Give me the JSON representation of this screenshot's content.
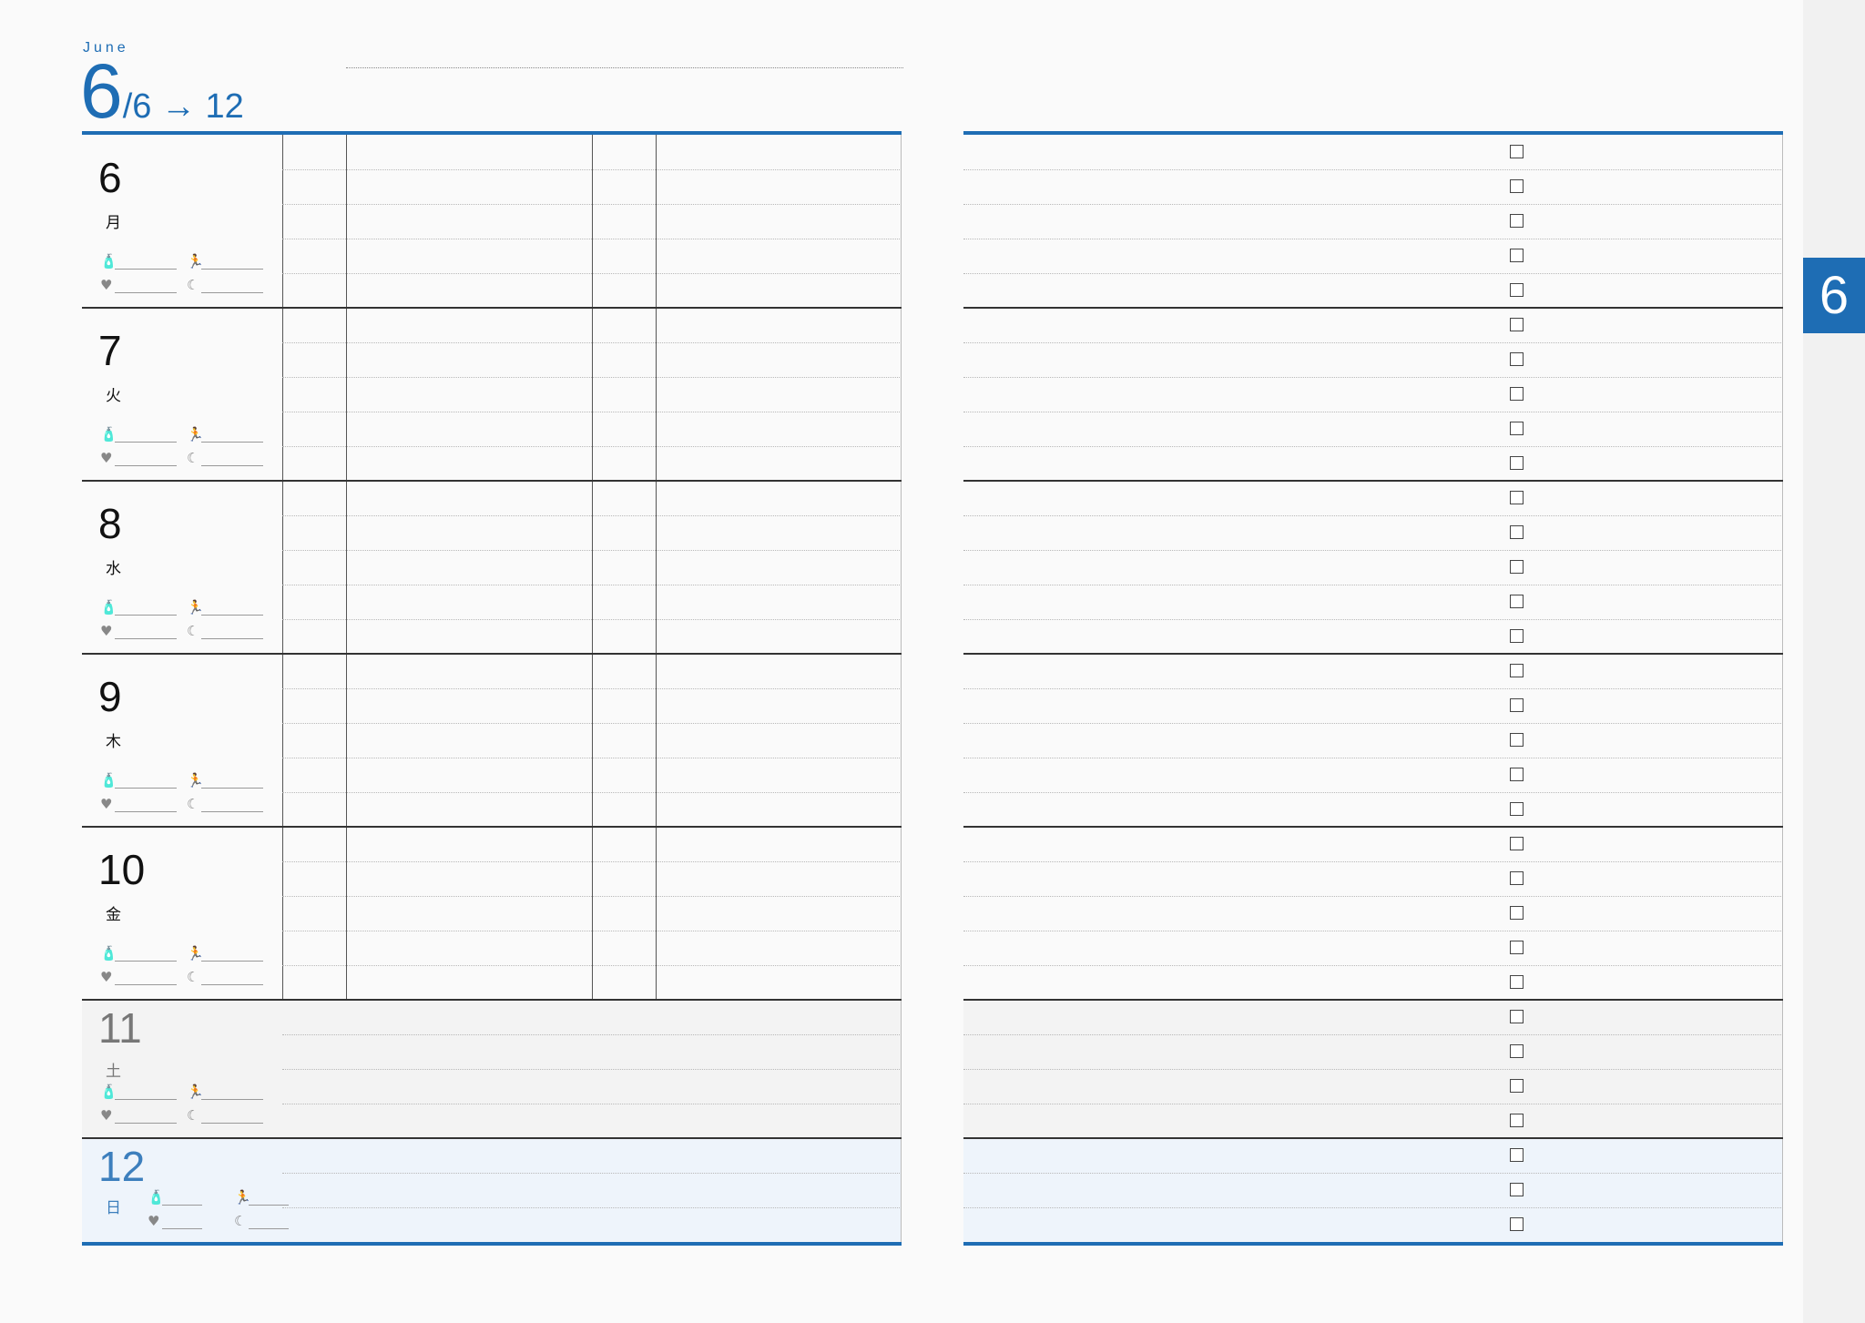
{
  "header": {
    "month": "June",
    "month_number": "6",
    "range_rest": "/6 → 12"
  },
  "tab_label": "6",
  "days": [
    {
      "num": "6",
      "weekday": "月",
      "style": "weekday",
      "lines": 5
    },
    {
      "num": "7",
      "weekday": "火",
      "style": "weekday",
      "lines": 5
    },
    {
      "num": "8",
      "weekday": "水",
      "style": "weekday",
      "lines": 5
    },
    {
      "num": "9",
      "weekday": "木",
      "style": "weekday",
      "lines": 5
    },
    {
      "num": "10",
      "weekday": "金",
      "style": "weekday",
      "lines": 5
    },
    {
      "num": "11",
      "weekday": "土",
      "style": "saturday",
      "lines": 4
    },
    {
      "num": "12",
      "weekday": "日",
      "style": "sunday",
      "lines": 3
    }
  ],
  "tracker_icons": [
    "water-bottle-icon",
    "exercise-icon",
    "heart-icon",
    "sleep-icon"
  ],
  "colors": {
    "accent": "#1e6db4",
    "sunday": "#3d7fbd",
    "saturday_bg": "#f3f3f3",
    "sunday_bg": "#eef4fb"
  }
}
